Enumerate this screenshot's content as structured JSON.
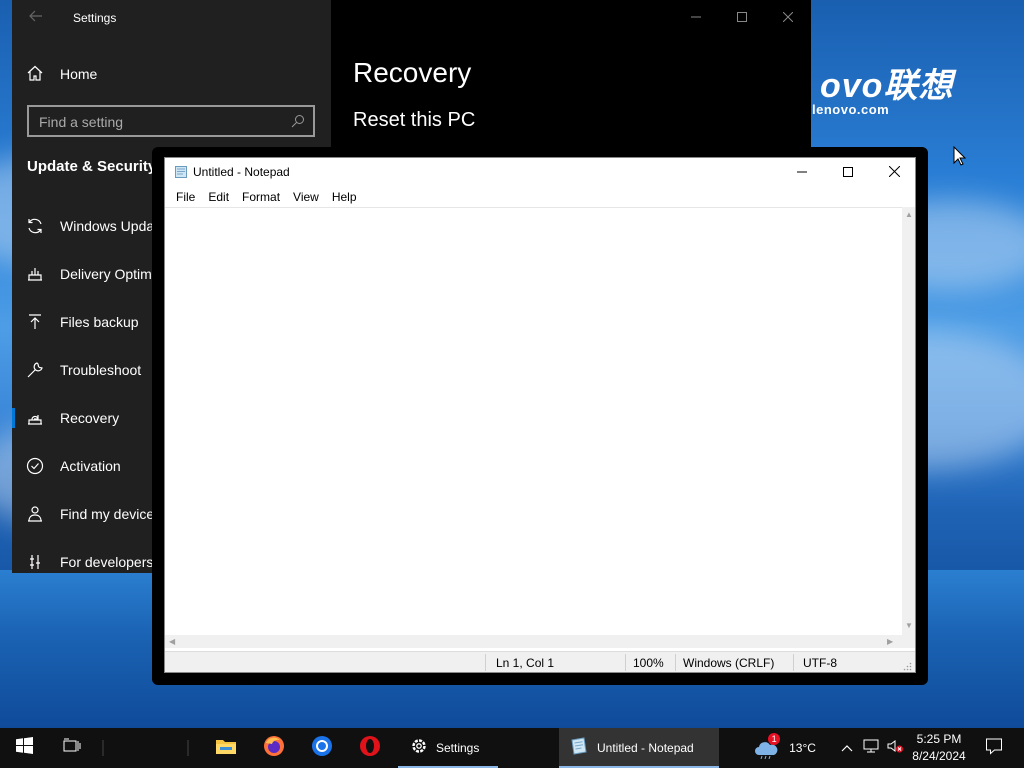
{
  "desktop": {
    "brand_text": "ovo联想",
    "brand_url": "lenovo.com"
  },
  "settings": {
    "window_title": "Settings",
    "home_label": "Home",
    "search_placeholder": "Find a setting",
    "section_title": "Update & Security",
    "nav_items": [
      {
        "label": "Windows Upda",
        "icon": "sync-icon"
      },
      {
        "label": "Delivery Optim",
        "icon": "delivery-optimization-icon"
      },
      {
        "label": "Files backup",
        "icon": "upload-arrow-icon"
      },
      {
        "label": "Troubleshoot",
        "icon": "wrench-icon"
      },
      {
        "label": "Recovery",
        "icon": "recovery-icon"
      },
      {
        "label": "Activation",
        "icon": "check-circle-icon"
      },
      {
        "label": "Find my device",
        "icon": "person-location-icon"
      },
      {
        "label": "For developers",
        "icon": "developer-icon"
      }
    ],
    "active_item": "Recovery",
    "page_heading": "Recovery",
    "sub_heading": "Reset this PC"
  },
  "notepad": {
    "window_title": "Untitled - Notepad",
    "menu": [
      "File",
      "Edit",
      "Format",
      "View",
      "Help"
    ],
    "content": "",
    "status": {
      "position": "Ln 1, Col 1",
      "zoom": "100%",
      "line_endings": "Windows (CRLF)",
      "encoding": "UTF-8"
    }
  },
  "taskbar": {
    "apps": [
      {
        "label": "Settings",
        "icon": "gear-icon"
      },
      {
        "label": "Untitled - Notepad",
        "icon": "notepad-icon"
      }
    ],
    "weather": {
      "temperature": "13°C",
      "badge": "1"
    },
    "clock": {
      "time": "5:25 PM",
      "date": "8/24/2024"
    }
  },
  "colors": {
    "accent": "#0078d7",
    "taskbar": "#101010",
    "settings_side": "#202020",
    "weather_badge": "#e81123"
  }
}
